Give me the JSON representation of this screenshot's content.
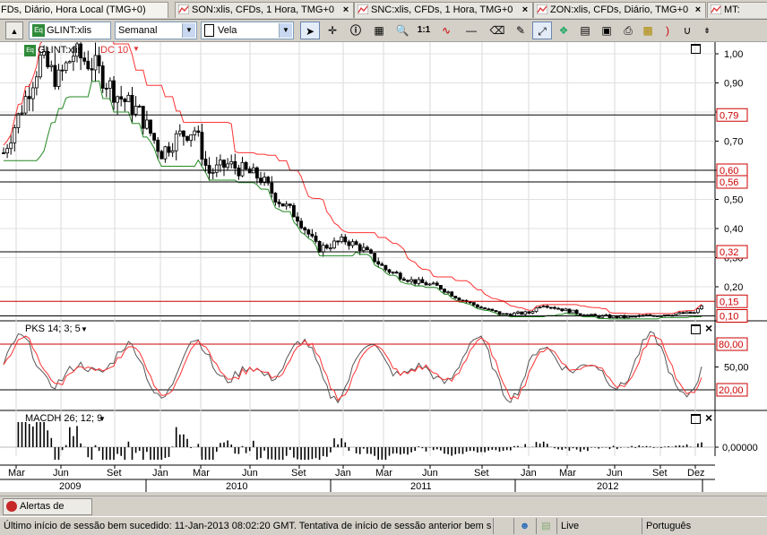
{
  "tabs": [
    {
      "label": "FDs, Diário, Hora Local (TMG+0)",
      "active": true
    },
    {
      "label": "SON:xlis, CFDs, 1 Hora, TMG+0"
    },
    {
      "label": "SNC:xlis, CFDs, 1 Hora, TMG+0"
    },
    {
      "label": "ZON:xlis, CFDs, Diário, TMG+0"
    },
    {
      "label": "MT:"
    }
  ],
  "toolbar": {
    "symbol": "GLINT:xlis",
    "period": "Semanal",
    "chart_style": "Vela",
    "ratio_label": "1:1"
  },
  "panels": {
    "price": {
      "symbol_label": "GLINT:xlis",
      "indicator_label": "DC 10",
      "y_ticks": [
        "1,00",
        "0,90",
        "0,80",
        "0,70",
        "0,60",
        "0,50",
        "0,40",
        "0,30",
        "0,20"
      ],
      "tags": [
        {
          "text": "0,79",
          "value": 0.79
        },
        {
          "text": "0,60",
          "value": 0.6
        },
        {
          "text": "0,56",
          "value": 0.56
        },
        {
          "text": "0,32",
          "value": 0.32
        },
        {
          "text": "0,15",
          "value": 0.15
        },
        {
          "text": "0,10",
          "value": 0.1
        }
      ]
    },
    "stoch": {
      "label": "PKS 14; 3; 5",
      "y_ticks": [
        "50,00"
      ],
      "tags": [
        {
          "text": "80,00",
          "value": 80
        },
        {
          "text": "20,00",
          "value": 20
        }
      ]
    },
    "macd": {
      "label": "MACDH 26; 12; 9",
      "y_ticks": [
        "0,00000"
      ]
    }
  },
  "time_axis": {
    "months": [
      "Mar",
      "Jun",
      "Set",
      "Jan",
      "Mar",
      "Jun",
      "Set",
      "Jan",
      "Mar",
      "Jun",
      "Set",
      "Jan",
      "Mar",
      "Jun",
      "Set",
      "Dez"
    ],
    "years": [
      "2009",
      "2010",
      "2011",
      "2012"
    ]
  },
  "alerts_button": "Alertas de Preço",
  "status": {
    "message": "Último início de sessão bem sucedido: 11-Jan-2013 08:02:20 GMT. Tentativa de início de sessão anterior bem sucedida",
    "connection": "Live",
    "language": "Português"
  },
  "colors": {
    "bull": "#ffffff",
    "bear": "#000000",
    "channel_upper": "#ff3333",
    "channel_lower": "#228822",
    "stoch_main": "#555555",
    "stoch_signal": "#ff3333",
    "tag_border": "#cc0000",
    "hline": "#000000"
  }
}
